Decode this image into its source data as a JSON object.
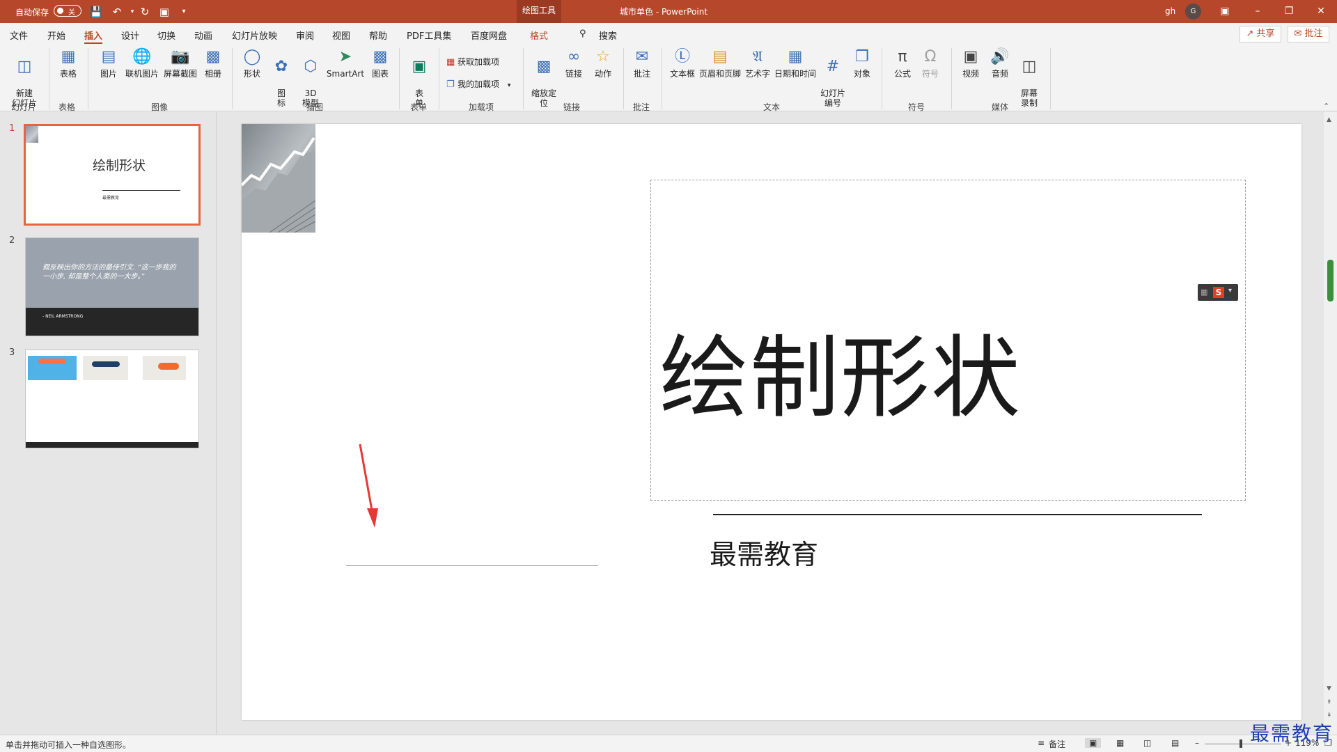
{
  "titlebar": {
    "autosave_label": "自动保存",
    "autosave_state": "关",
    "context_tab": "绘图工具",
    "doc_title": "城市单色  -  PowerPoint",
    "user": "gh",
    "avatar": "G"
  },
  "menu": {
    "items": [
      "文件",
      "开始",
      "插入",
      "设计",
      "切换",
      "动画",
      "幻灯片放映",
      "审阅",
      "视图",
      "帮助",
      "PDF工具集",
      "百度网盘",
      "格式"
    ],
    "search": "搜索",
    "share": "共享",
    "comment": "批注"
  },
  "ribbon": {
    "new_slide": "新建\n幻灯片",
    "table": "表格",
    "picture": "图片",
    "online_picture": "联机图片",
    "screenshot": "屏幕截图",
    "album": "相册",
    "shapes": "形状",
    "icons": "图\n标",
    "model3d": "3D\n模型",
    "smartart": "SmartArt",
    "chart": "图表",
    "forms": "表\n单",
    "get_addins": "获取加载项",
    "my_addins": "我的加载项",
    "zoom": "缩放定\n位",
    "link": "链接",
    "action": "动作",
    "comment": "批注",
    "textbox": "文本框",
    "header_footer": "页眉和页脚",
    "wordart": "艺术字",
    "datetime": "日期和时间",
    "slide_number": "幻灯片\n编号",
    "object": "对象",
    "equation": "公式",
    "symbol": "符号",
    "video": "视频",
    "audio": "音频",
    "screen_record": "屏幕\n录制",
    "groups": [
      "幻灯片",
      "表格",
      "图像",
      "插图",
      "表单",
      "加载项",
      "链接",
      "批注",
      "文本",
      "符号",
      "媒体"
    ]
  },
  "thumbnails": [
    {
      "num": "1",
      "title": "绘制形状",
      "sub": "最需教育"
    },
    {
      "num": "2",
      "quote": "假反映出你的方法的最佳引文. “这一步我的一小步, 却是整个人类的一大步。”",
      "author": "- NEIL ARMSTRONG"
    },
    {
      "num": "3"
    }
  ],
  "slide": {
    "title": "绘制形状",
    "subtitle": "最需教育"
  },
  "status": {
    "hint": "单击并拖动可插入一种自选图形。",
    "notes": "备注",
    "zoom": "119%"
  },
  "watermark": "最需教育",
  "colors": {
    "accent": "#b7472a",
    "selection": "#e8643f",
    "arrow": "#e53935"
  }
}
